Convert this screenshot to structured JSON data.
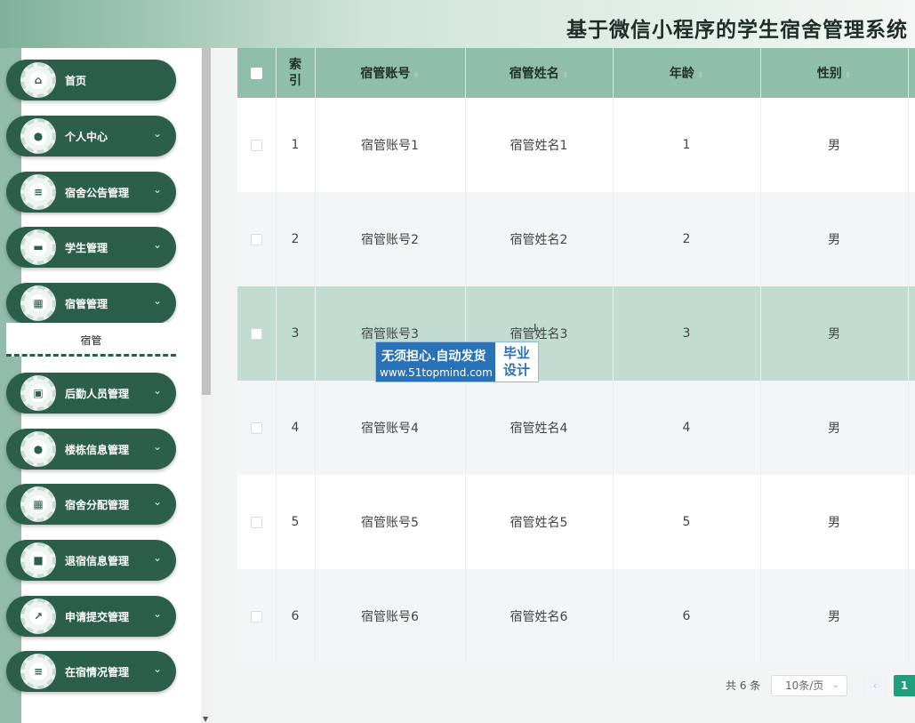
{
  "header": {
    "title": "基于微信小程序的学生宿舍管理系统"
  },
  "sidebar": {
    "items": [
      {
        "label": "首页",
        "icon": "home-icon",
        "glyph": "⌂",
        "expandable": false
      },
      {
        "label": "个人中心",
        "icon": "user-icon",
        "glyph": "●",
        "expandable": true
      },
      {
        "label": "宿舍公告管理",
        "icon": "list-icon",
        "glyph": "≡",
        "expandable": true
      },
      {
        "label": "学生管理",
        "icon": "monitor-icon",
        "glyph": "▬",
        "expandable": true
      },
      {
        "label": "宿管管理",
        "icon": "grid-icon",
        "glyph": "▦",
        "expandable": true
      },
      {
        "label": "后勤人员管理",
        "icon": "clipboard-icon",
        "glyph": "▣",
        "expandable": true
      },
      {
        "label": "楼栋信息管理",
        "icon": "user-icon",
        "glyph": "●",
        "expandable": true
      },
      {
        "label": "宿舍分配管理",
        "icon": "grid-icon",
        "glyph": "▦",
        "expandable": true
      },
      {
        "label": "退宿信息管理",
        "icon": "video-icon",
        "glyph": "■",
        "expandable": true
      },
      {
        "label": "申请提交管理",
        "icon": "chart-icon",
        "glyph": "↗",
        "expandable": true
      },
      {
        "label": "在宿情况管理",
        "icon": "list-icon",
        "glyph": "≡",
        "expandable": true
      }
    ],
    "submenu": {
      "label": "宿管"
    }
  },
  "table": {
    "columns": [
      "索\n引",
      "宿管账号",
      "宿管姓名",
      "年龄",
      "性别"
    ],
    "rows": [
      {
        "index": "1",
        "account": "宿管账号1",
        "name": "宿管姓名1",
        "age": "1",
        "gender": "男"
      },
      {
        "index": "2",
        "account": "宿管账号2",
        "name": "宿管姓名2",
        "age": "2",
        "gender": "男"
      },
      {
        "index": "3",
        "account": "宿管账号3",
        "name": "宿管姓名3",
        "age": "3",
        "gender": "男"
      },
      {
        "index": "4",
        "account": "宿管账号4",
        "name": "宿管姓名4",
        "age": "4",
        "gender": "男"
      },
      {
        "index": "5",
        "account": "宿管账号5",
        "name": "宿管姓名5",
        "age": "5",
        "gender": "男"
      },
      {
        "index": "6",
        "account": "宿管账号6",
        "name": "宿管姓名6",
        "age": "6",
        "gender": "男"
      }
    ]
  },
  "pagination": {
    "total": "共 6 条",
    "page_size": "10条/页",
    "prev": "‹",
    "current_page": "1"
  },
  "watermark": {
    "line1": "无须担心.自动发货",
    "line2": "www.51topmind.com",
    "box": "毕业\n设计"
  },
  "colors": {
    "menu_bg": "#2c5f4b",
    "header_row": "#8fbfab",
    "highlight_row": "#c1dcd0",
    "accent": "#1f9f7b"
  }
}
